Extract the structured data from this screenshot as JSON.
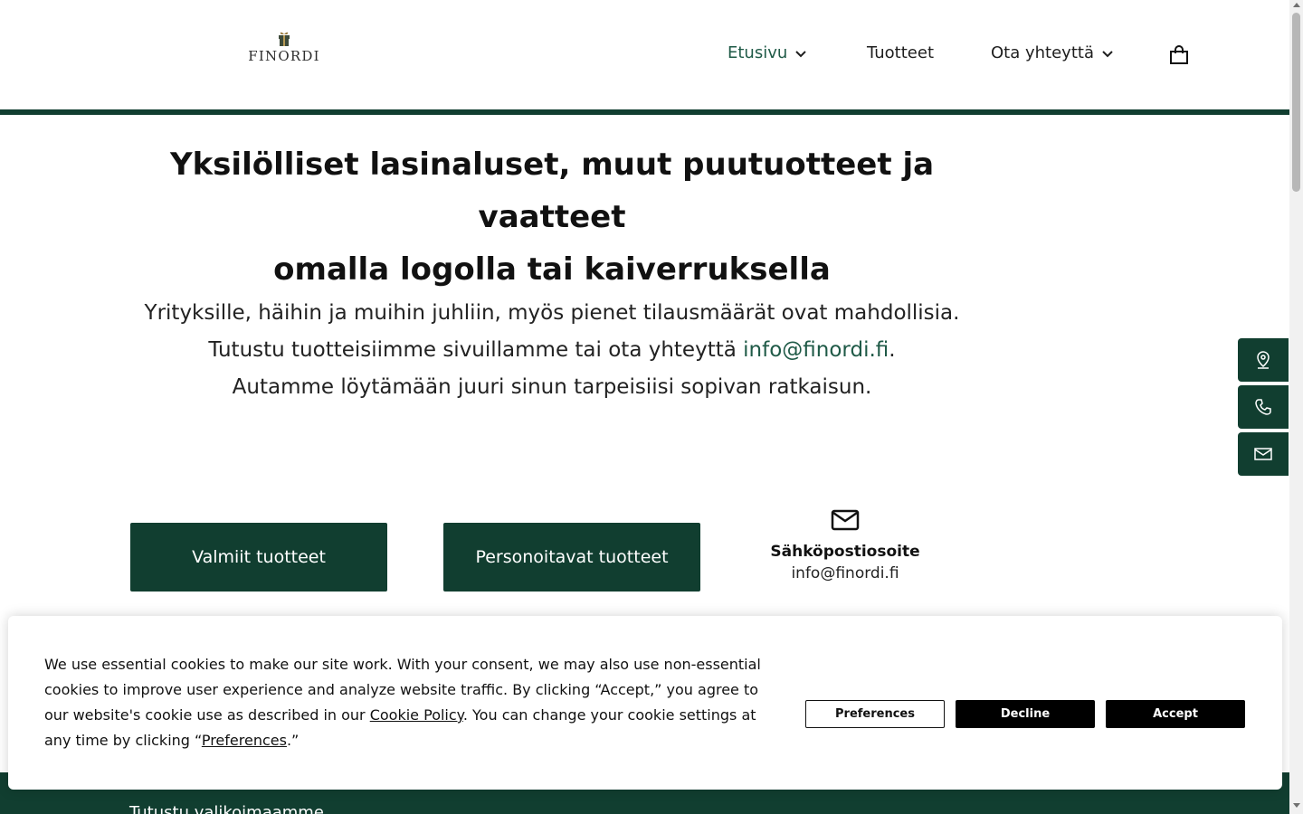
{
  "header": {
    "logo_text": "FINORDI",
    "nav": [
      {
        "label": "Etusivu",
        "has_dropdown": true,
        "active": true
      },
      {
        "label": "Tuotteet",
        "has_dropdown": false,
        "active": false
      },
      {
        "label": "Ota yhteyttä",
        "has_dropdown": true,
        "active": false
      }
    ],
    "cart_icon": "shopping-bag-icon"
  },
  "hero": {
    "title_line1": "Yksilölliset lasinaluset, muut puutuotteet ja vaatteet",
    "title_line2": "omalla logolla tai kaiverruksella",
    "text_line1": "Yrityksille, häihin ja muihin juhliin, myös pienet tilausmäärät ovat mahdollisia.",
    "text_line2_prefix": "Tutustu tuotteisiimme sivuillamme tai ota yhteyttä ",
    "text_line2_email": "info@finordi.fi",
    "text_line2_suffix": ".",
    "text_line3": "Autamme löytämään juuri sinun tarpeisiisi sopivan ratkaisun."
  },
  "side_buttons": [
    "location-pin-icon",
    "phone-icon",
    "mail-icon"
  ],
  "actions": {
    "ready_products": "Valmiit tuotteet",
    "custom_products": "Personoitavat tuotteet",
    "contact_label": "Sähköpostiosoite",
    "contact_value": "info@finordi.fi"
  },
  "footer": {
    "teaser": "Tutustu valikoimaamme"
  },
  "cookie": {
    "text_part1": "We use essential cookies to make our site work. With your consent, we may also use non-essential cookies to improve user experience and analyze website traffic. By clicking “Accept,” you agree to our website's cookie use as described in our ",
    "cookie_policy_link": "Cookie Policy",
    "text_part2": ". You can change your cookie settings at any time by clicking “",
    "preferences_link": "Preferences",
    "text_part3": ".”",
    "preferences_button": "Preferences",
    "decline_button": "Decline",
    "accept_button": "Accept"
  },
  "colors": {
    "brand_green": "#113e30",
    "link_green": "#1f5a47"
  }
}
